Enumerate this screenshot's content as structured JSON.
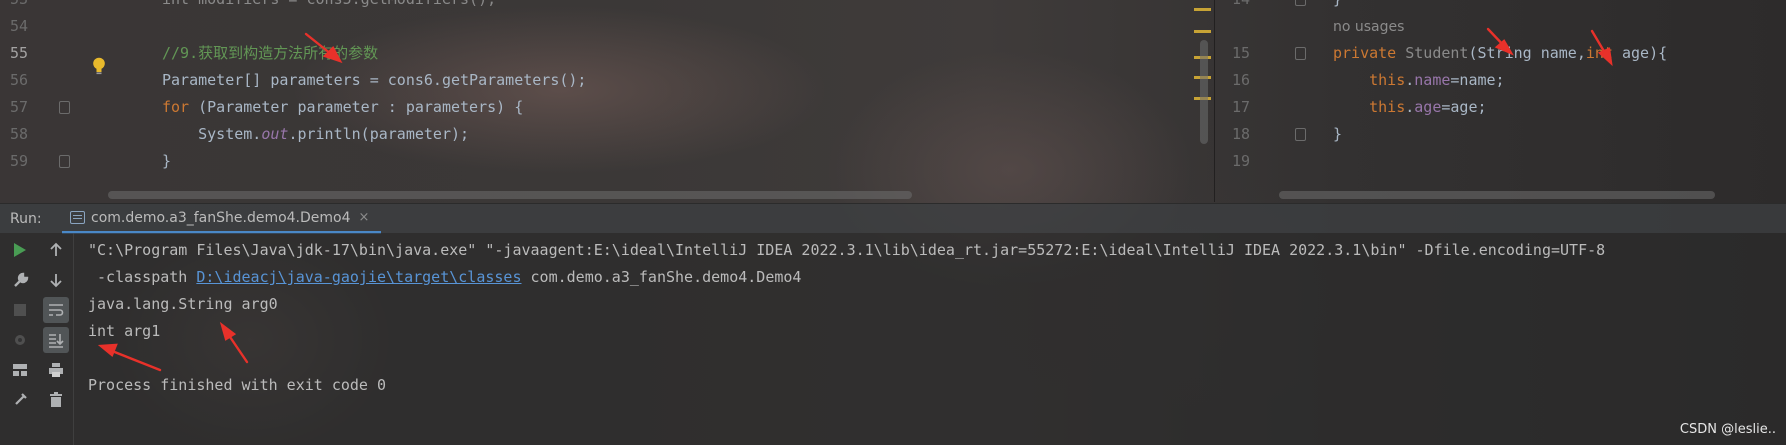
{
  "editor_left": {
    "lines": [
      {
        "num": "53",
        "segments": [
          {
            "t": "int modifiers = cons5.getModifiers();",
            "c": "dim"
          }
        ]
      },
      {
        "num": "54",
        "segments": []
      },
      {
        "num": "55",
        "segments": [
          {
            "t": "//9.获取到构造方法所有的参数",
            "c": "cm"
          }
        ]
      },
      {
        "num": "56",
        "segments": [
          {
            "t": "Parameter[] parameters = cons6.getParameters();",
            "c": "ty"
          }
        ]
      },
      {
        "num": "57",
        "segments": [
          {
            "t": "for",
            "c": "kw"
          },
          {
            "t": " (Parameter parameter : parameters) {",
            "c": "ty"
          }
        ]
      },
      {
        "num": "58",
        "segments": [
          {
            "t": "    System.",
            "c": "ty"
          },
          {
            "t": "out",
            "c": "st"
          },
          {
            "t": ".println(parameter);",
            "c": "ty"
          }
        ]
      },
      {
        "num": "59",
        "segments": [
          {
            "t": "}",
            "c": "ty"
          }
        ]
      }
    ],
    "current_line": "55",
    "bulb_icon": "lightbulb-icon"
  },
  "editor_right": {
    "lines": [
      {
        "num": "14",
        "segments": [
          {
            "t": "}",
            "c": "ty"
          }
        ]
      },
      {
        "num": "",
        "segments": [
          {
            "t": "no usages",
            "c": "hint"
          }
        ]
      },
      {
        "num": "15",
        "segments": [
          {
            "t": "private ",
            "c": "kw"
          },
          {
            "t": "Student",
            "c": "dim"
          },
          {
            "t": "(String name,",
            "c": "ty"
          },
          {
            "t": "int",
            "c": "kw"
          },
          {
            "t": " age){",
            "c": "ty"
          }
        ]
      },
      {
        "num": "16",
        "segments": [
          {
            "t": "    this",
            "c": "kw"
          },
          {
            "t": ".",
            "c": "ty"
          },
          {
            "t": "name",
            "c": "fld"
          },
          {
            "t": "=name;",
            "c": "ty"
          }
        ]
      },
      {
        "num": "17",
        "segments": [
          {
            "t": "    this",
            "c": "kw"
          },
          {
            "t": ".",
            "c": "ty"
          },
          {
            "t": "age",
            "c": "fld"
          },
          {
            "t": "=age;",
            "c": "ty"
          }
        ]
      },
      {
        "num": "18",
        "segments": [
          {
            "t": "}",
            "c": "ty"
          }
        ]
      },
      {
        "num": "19",
        "segments": []
      }
    ]
  },
  "run": {
    "label": "Run:",
    "tab_title": "com.demo.a3_fanShe.demo4.Demo4",
    "tab_close": "×",
    "toolbar_left": [
      "run-icon",
      "wrench-icon",
      "stop-icon",
      "debug-icon",
      "layout-icon",
      "pin-icon"
    ],
    "toolbar_right": [
      "up-arrow-icon",
      "down-arrow-icon",
      "soft-wrap-icon",
      "scroll-to-end-icon",
      "print-icon",
      "trash-icon"
    ]
  },
  "console": {
    "cmd_line1": "\"C:\\Program Files\\Java\\jdk-17\\bin\\java.exe\" \"-javaagent:E:\\ideal\\IntelliJ IDEA 2022.3.1\\lib\\idea_rt.jar=55272:E:\\ideal\\IntelliJ IDEA 2022.3.1\\bin\" -Dfile.encoding=UTF-8",
    "cmd_line2_prefix": " -classpath ",
    "cmd_line2_link": "D:\\ideacj\\java-gaojie\\target\\classes",
    "cmd_line2_suffix": " com.demo.a3_fanShe.demo4.Demo4",
    "out1": "java.lang.String arg0",
    "out2": "int arg1",
    "exit": "Process finished with exit code 0"
  },
  "watermark": "CSDN @leslie..",
  "colors": {
    "keyword": "#cc7832",
    "comment": "#629755",
    "field": "#9876aa",
    "link": "#5894d6",
    "arrow": "#e8312a"
  }
}
